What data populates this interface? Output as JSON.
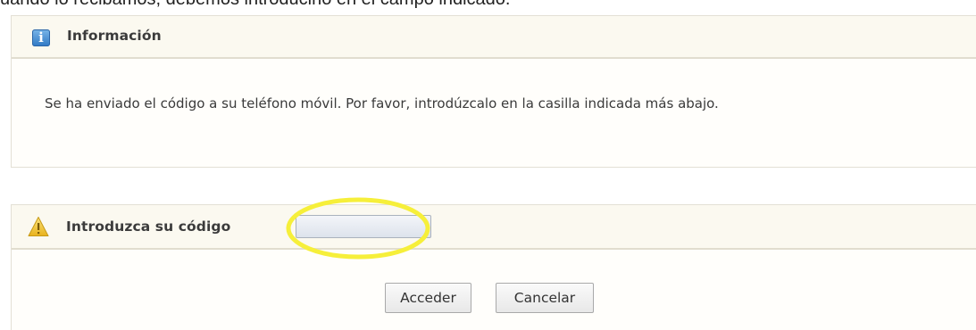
{
  "caption_fragment": "uando lo recibamos, debemos introducirlo en el campo indicado.",
  "info_panel": {
    "title": "Información",
    "icon": "info-icon",
    "message": "Se ha enviado el código a su teléfono móvil. Por favor, introdúzcalo en la casilla indicada más abajo."
  },
  "code_panel": {
    "title": "Introduzca su código",
    "icon": "warning-icon",
    "input_value": "",
    "accept_label": "Acceder",
    "cancel_label": "Cancelar"
  },
  "colors": {
    "info_icon_blue": "#2f78c4",
    "warning_icon_yellow": "#f2c534",
    "highlight_ellipse": "#f6ef3a",
    "panel_background": "#fffefb"
  }
}
